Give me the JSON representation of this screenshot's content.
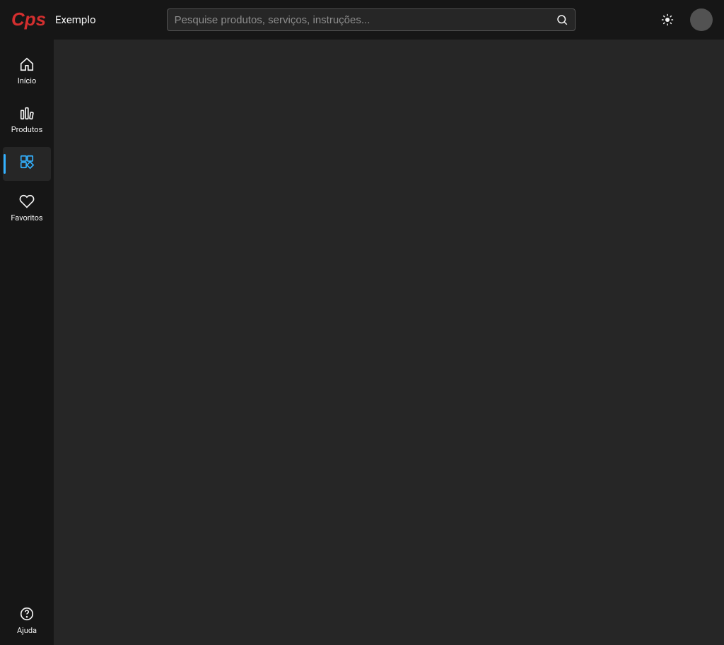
{
  "header": {
    "brand": "Exemplo",
    "search_placeholder": "Pesquise produtos, serviços, instruções..."
  },
  "sidebar": {
    "items": [
      {
        "label": "Início"
      },
      {
        "label": "Produtos"
      },
      {
        "label": ""
      },
      {
        "label": "Favoritos"
      }
    ],
    "bottom": {
      "label": "Ajuda"
    }
  }
}
